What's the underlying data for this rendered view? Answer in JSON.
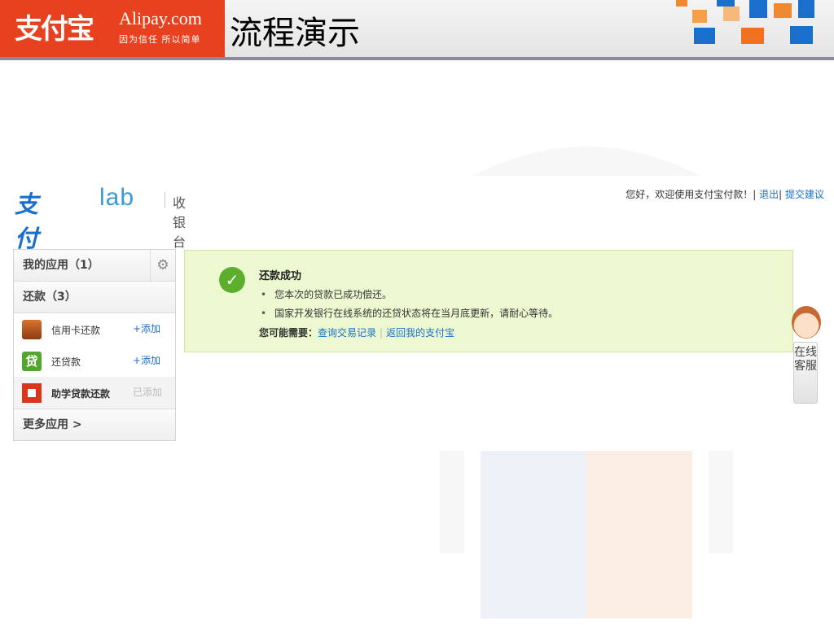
{
  "slide": {
    "logo_cn": "支付宝",
    "logo_en": "Alipay.com",
    "logo_slogan": "因为信任 所以简单",
    "title": "流程演示"
  },
  "header": {
    "brand_cn": "支付宝",
    "brand_lab": "lab",
    "cashier": "收银台",
    "greeting": "您好，欢迎使用支付宝付款！",
    "logout": "退出",
    "feedback": "提交建议",
    "separator": "|"
  },
  "sidebar": {
    "my_apps": "我的应用（1）",
    "repay_header": "还款（3）",
    "items": [
      {
        "name": "信用卡还款",
        "action": "+添加",
        "icon": "credit-card-icon",
        "color": "#b5561f"
      },
      {
        "name": "还贷款",
        "action": "+添加",
        "icon": "loan-icon",
        "color": "#52a52e"
      },
      {
        "name": "助学贷款还款",
        "action": "已添加",
        "icon": "student-loan-icon",
        "color": "#d8371c"
      }
    ],
    "more": "更多应用 >"
  },
  "success": {
    "title": "还款成功",
    "bullets": [
      "您本次的贷款已成功偿还。",
      "国家开发银行在线系统的还贷状态将在当月底更新，请耐心等待。"
    ],
    "need_label": "您可能需要：",
    "link1": "查询交易记录",
    "link2": "返回我的支付宝",
    "sep": "|"
  },
  "online_service": "在线客服",
  "colors": {
    "brand_orange": "#e8411f",
    "brand_blue": "#1a6fcc",
    "success_bg": "#ecf8cf",
    "check_green": "#5caf2d"
  }
}
